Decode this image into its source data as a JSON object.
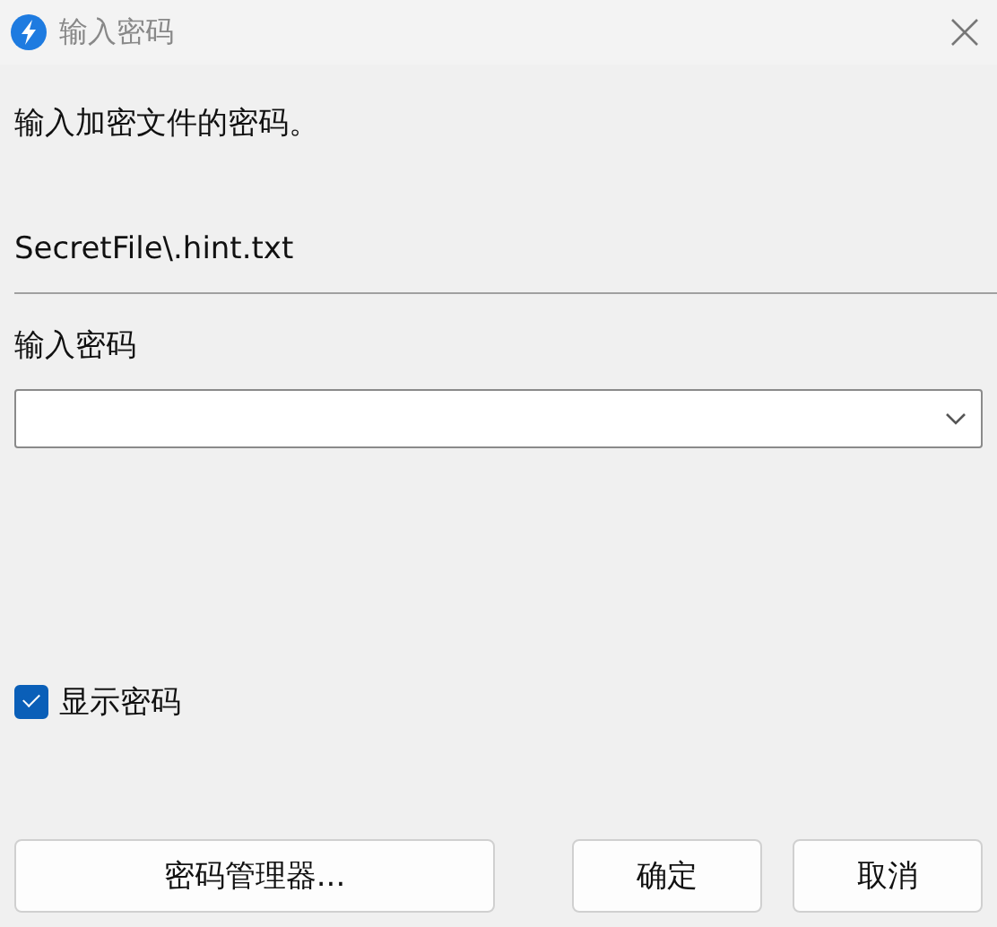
{
  "window": {
    "title": "输入密码"
  },
  "message": "输入加密文件的密码。",
  "file_path": "SecretFile\\.hint.txt",
  "password": {
    "label": "输入密码",
    "kind": "dropdown"
  },
  "show_password": {
    "label": "显示密码",
    "checked": true
  },
  "buttons": [
    {
      "label": "密码管理器...",
      "kind": "wide"
    },
    {
      "label": "确定",
      "kind": "normal"
    },
    {
      "label": "取消",
      "kind": "normal"
    }
  ]
}
